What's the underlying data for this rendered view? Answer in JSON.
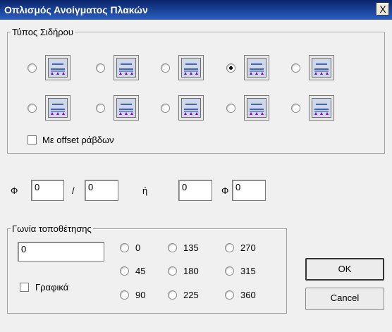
{
  "window": {
    "title": "Οπλισμός Ανοίγματος Πλακών",
    "close_label": "X"
  },
  "rebar_type": {
    "legend": "Τύπος Σιδήρου",
    "options": [
      {
        "icon": "rebar-type-1-icon",
        "checked": false
      },
      {
        "icon": "rebar-type-2-icon",
        "checked": false
      },
      {
        "icon": "rebar-type-3-icon",
        "checked": false
      },
      {
        "icon": "rebar-type-4-icon",
        "checked": true
      },
      {
        "icon": "rebar-type-5-icon",
        "checked": false
      },
      {
        "icon": "rebar-type-6-icon",
        "checked": false
      },
      {
        "icon": "rebar-type-7-icon",
        "checked": false
      },
      {
        "icon": "rebar-type-8-icon",
        "checked": false
      },
      {
        "icon": "rebar-type-9-icon",
        "checked": false
      },
      {
        "icon": "rebar-type-10-icon",
        "checked": false
      }
    ],
    "offset_label": "Με offset ράβδων",
    "offset_checked": false
  },
  "diameter": {
    "phi1_label": "Φ",
    "phi1_value": "0",
    "slash_label": "/",
    "spacing_value": "0",
    "or_label": "ή",
    "count_value": "0",
    "phi2_label": "Φ",
    "phi2_value": "0"
  },
  "angle": {
    "legend": "Γωνία τοποθέτησης",
    "value": "0",
    "graphic_label": "Γραφικά",
    "graphic_checked": false,
    "options": [
      "0",
      "135",
      "270",
      "45",
      "180",
      "315",
      "90",
      "225",
      "360"
    ]
  },
  "buttons": {
    "ok": "OK",
    "cancel": "Cancel"
  },
  "colors": {
    "accent": "#2a5fc4",
    "rebar": "#1a3fa8",
    "support": "#8a00c8"
  }
}
